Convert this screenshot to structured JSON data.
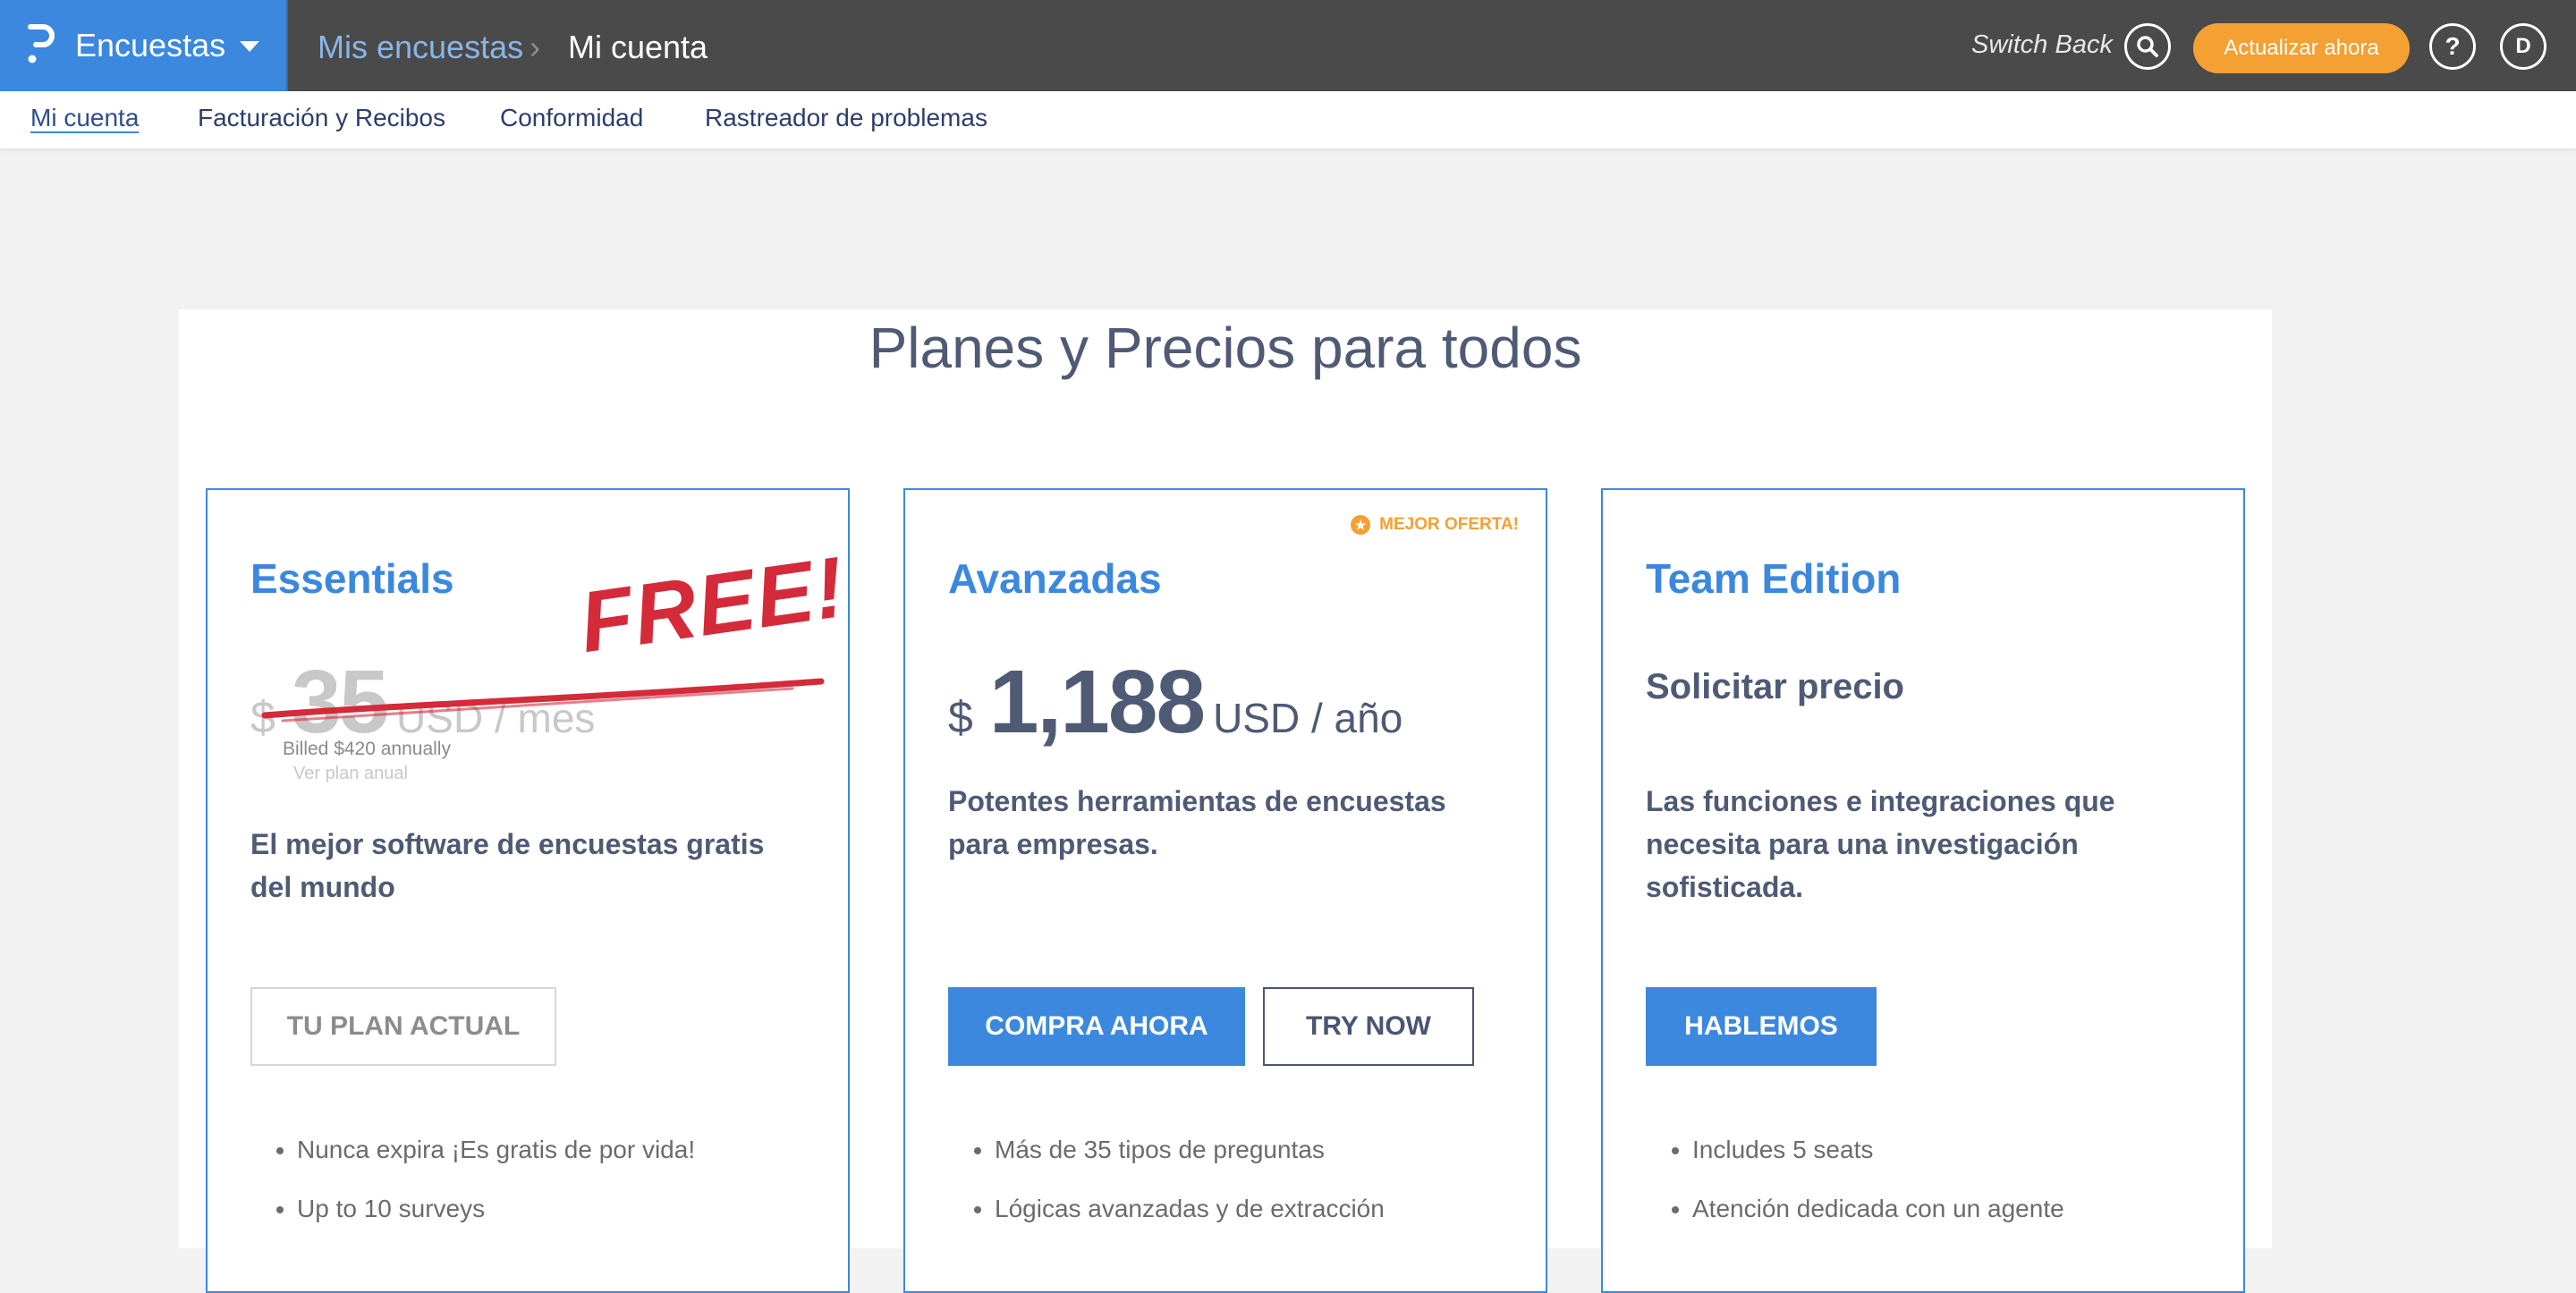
{
  "header": {
    "app_name": "Encuestas",
    "breadcrumb": {
      "parent": "Mis encuestas",
      "separator": "›",
      "current": "Mi cuenta"
    },
    "switch_back": "Switch Back",
    "upgrade_label": "Actualizar ahora",
    "help_label": "?",
    "avatar_initial": "D"
  },
  "subnav": {
    "items": [
      {
        "label": "Mi cuenta"
      },
      {
        "label": "Facturación y Recibos"
      },
      {
        "label": "Conformidad"
      },
      {
        "label": "Rastreador de problemas"
      }
    ]
  },
  "pricing": {
    "title": "Planes y Precios para todos",
    "plans": [
      {
        "name": "Essentials",
        "currency": "$",
        "amount": "35",
        "unit": "USD / mes",
        "overlay": "FREE!",
        "billed": "Billed $420 annually",
        "view_annual": "Ver plan anual",
        "description": "El mejor software de encuestas gratis del mundo",
        "buttons": [
          {
            "label": "TU PLAN ACTUAL"
          }
        ],
        "features": [
          "Nunca expira ¡Es gratis de por vida!",
          "Up to 10 surveys"
        ]
      },
      {
        "name": "Avanzadas",
        "badge": "MEJOR OFERTA!",
        "currency": "$",
        "amount": "1,188",
        "unit": "USD / año",
        "description": "Potentes herramientas de encuestas para empresas.",
        "buttons": [
          {
            "label": "COMPRA AHORA"
          },
          {
            "label": "TRY NOW"
          }
        ],
        "features": [
          "Más de 35 tipos de preguntas",
          "Lógicas avanzadas y de extracción"
        ]
      },
      {
        "name": "Team Edition",
        "price_text": "Solicitar precio",
        "description": "Las funciones e integraciones que necesita para una investigación sofisticada.",
        "buttons": [
          {
            "label": "HABLEMOS"
          }
        ],
        "features": [
          "Includes 5 seats",
          "Atención dedicada con un agente"
        ]
      }
    ]
  },
  "colors": {
    "brand": "#3b88de",
    "topbar": "#4a4a4a",
    "upgrade": "#f5a033",
    "free_mark": "#d42a3a"
  }
}
